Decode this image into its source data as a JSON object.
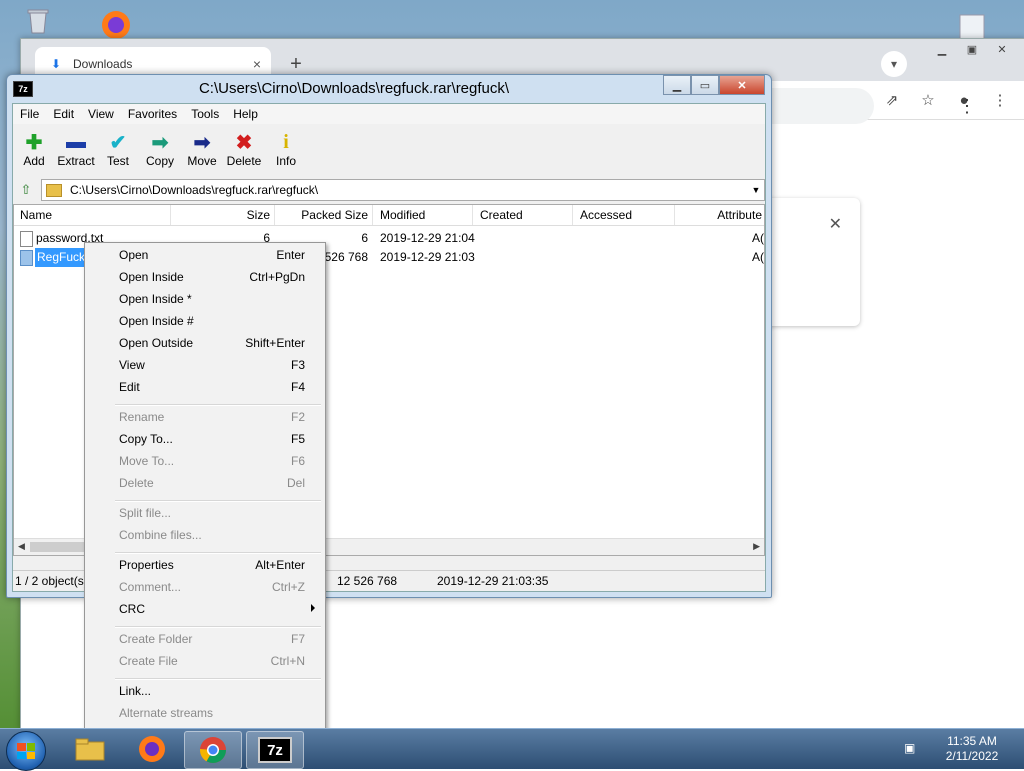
{
  "chrome": {
    "tab_title": "Downloads",
    "tab_close": "×",
    "new_tab": "+",
    "menu_dots": "⋮"
  },
  "zip": {
    "title": "C:\\Users\\Cirno\\Downloads\\regfuck.rar\\regfuck\\",
    "app_icon": "7z",
    "menu": [
      "File",
      "Edit",
      "View",
      "Favorites",
      "Tools",
      "Help"
    ],
    "toolbar": [
      {
        "label": "Add",
        "icon": "plus-icon",
        "glyph": "✚",
        "color": "#1fa12a"
      },
      {
        "label": "Extract",
        "icon": "minus-icon",
        "glyph": "▬",
        "color": "#1c3ea8"
      },
      {
        "label": "Test",
        "icon": "test-icon",
        "glyph": "✔",
        "color": "#19b2c9"
      },
      {
        "label": "Copy",
        "icon": "copy-arrow-icon",
        "glyph": "➡",
        "color": "#1a9a7a"
      },
      {
        "label": "Move",
        "icon": "move-arrow-icon",
        "glyph": "➡",
        "color": "#1a2b8a"
      },
      {
        "label": "Delete",
        "icon": "delete-icon",
        "glyph": "✖",
        "color": "#d21d1d"
      },
      {
        "label": "Info",
        "icon": "info-icon",
        "glyph": "i",
        "color": "#d8b400"
      }
    ],
    "address": "C:\\Users\\Cirno\\Downloads\\regfuck.rar\\regfuck\\",
    "columns": [
      "Name",
      "Size",
      "Packed Size",
      "Modified",
      "Created",
      "Accessed",
      "Attribute"
    ],
    "rows": [
      {
        "name": "password.txt",
        "size": "6",
        "packed": "6",
        "modified": "2019-12-29 21:04",
        "attr": "A("
      },
      {
        "name": "RegFuck.",
        "size": "",
        "packed": "526 768",
        "modified": "2019-12-29 21:03",
        "attr": "A("
      }
    ],
    "status": {
      "count": "1 / 2 object(s)",
      "packed": "12 526 768",
      "date": "2019-12-29 21:03:35"
    }
  },
  "context_menu": {
    "items": [
      {
        "label": "Open",
        "shortcut": "Enter",
        "disabled": false
      },
      {
        "label": "Open Inside",
        "shortcut": "Ctrl+PgDn",
        "disabled": false
      },
      {
        "label": "Open Inside *",
        "shortcut": "",
        "disabled": false
      },
      {
        "label": "Open Inside #",
        "shortcut": "",
        "disabled": false
      },
      {
        "label": "Open Outside",
        "shortcut": "Shift+Enter",
        "disabled": false
      },
      {
        "label": "View",
        "shortcut": "F3",
        "disabled": false
      },
      {
        "label": "Edit",
        "shortcut": "F4",
        "disabled": false
      },
      {
        "label": "Rename",
        "shortcut": "F2",
        "disabled": true
      },
      {
        "label": "Copy To...",
        "shortcut": "F5",
        "disabled": false
      },
      {
        "label": "Move To...",
        "shortcut": "F6",
        "disabled": true
      },
      {
        "label": "Delete",
        "shortcut": "Del",
        "disabled": true
      },
      {
        "label": "Split file...",
        "shortcut": "",
        "disabled": true
      },
      {
        "label": "Combine files...",
        "shortcut": "",
        "disabled": true
      },
      {
        "label": "Properties",
        "shortcut": "Alt+Enter",
        "disabled": false
      },
      {
        "label": "Comment...",
        "shortcut": "Ctrl+Z",
        "disabled": true
      },
      {
        "label": "CRC",
        "shortcut": "",
        "disabled": false
      },
      {
        "label": "Create Folder",
        "shortcut": "F7",
        "disabled": true
      },
      {
        "label": "Create File",
        "shortcut": "Ctrl+N",
        "disabled": true
      },
      {
        "label": "Link...",
        "shortcut": "",
        "disabled": false
      },
      {
        "label": "Alternate streams",
        "shortcut": "",
        "disabled": true
      }
    ]
  },
  "taskbar": {
    "time": "11:35 AM",
    "date": "2/11/2022",
    "apps": [
      "File Explorer",
      "Firefox",
      "Chrome",
      "7-Zip"
    ]
  }
}
